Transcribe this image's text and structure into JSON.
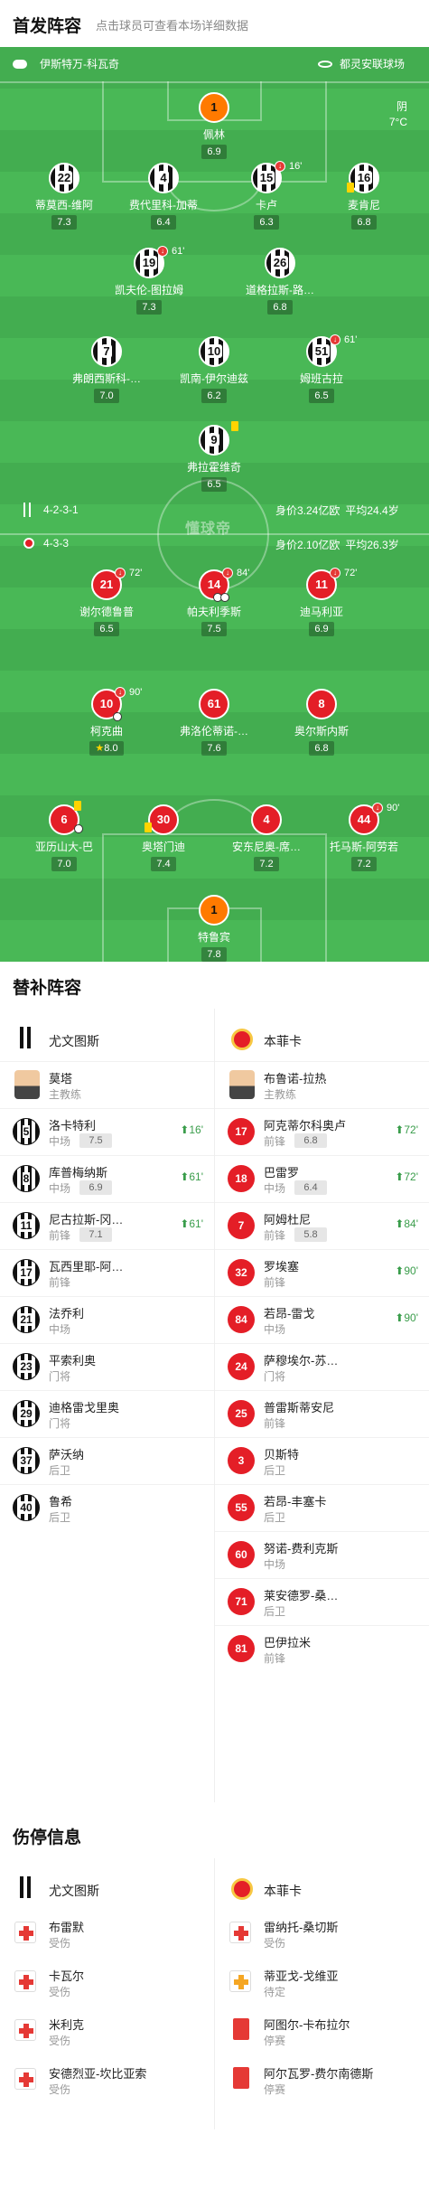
{
  "header": {
    "title": "首发阵容",
    "subtitle": "点击球员可查看本场详细数据"
  },
  "match": {
    "referee": "伊斯特万-科瓦奇",
    "venue": "都灵安联球场",
    "weather": "阴",
    "temperature": "7°C",
    "watermark": "懂球帝"
  },
  "home": {
    "name": "尤文图斯",
    "formation": "4-2-3-1",
    "value": "身价3.24亿欧",
    "avg_age": "平均24.4岁",
    "players": [
      {
        "num": "1",
        "name": "佩林",
        "rating": "6.9",
        "gk": true
      },
      {
        "num": "22",
        "name": "蒂莫西-维阿",
        "rating": "7.3"
      },
      {
        "num": "4",
        "name": "费代里科-加蒂",
        "rating": "6.4"
      },
      {
        "num": "15",
        "name": "卡卢",
        "rating": "6.3",
        "sub_min": "16'"
      },
      {
        "num": "16",
        "name": "麦肯尼",
        "rating": "6.8"
      },
      {
        "num": "19",
        "name": "凯夫伦-图拉姆",
        "rating": "7.3",
        "sub_min": "61'"
      },
      {
        "num": "26",
        "name": "道格拉斯-路…",
        "rating": "6.8"
      },
      {
        "num": "7",
        "name": "弗朗西斯科-…",
        "rating": "7.0"
      },
      {
        "num": "10",
        "name": "凯南-伊尔迪兹",
        "rating": "6.2"
      },
      {
        "num": "51",
        "name": "姆班古拉",
        "rating": "6.5",
        "sub_min": "61'"
      },
      {
        "num": "9",
        "name": "弗拉霍维奇",
        "rating": "6.5"
      }
    ]
  },
  "away": {
    "name": "本菲卡",
    "formation": "4-3-3",
    "value": "身价2.10亿欧",
    "avg_age": "平均26.3岁",
    "players": [
      {
        "num": "21",
        "name": "谢尔德鲁普",
        "rating": "6.5",
        "sub_min": "72'"
      },
      {
        "num": "14",
        "name": "帕夫利季斯",
        "rating": "7.5",
        "sub_min": "84'"
      },
      {
        "num": "11",
        "name": "迪马利亚",
        "rating": "6.9",
        "sub_min": "72'"
      },
      {
        "num": "10",
        "name": "柯克曲",
        "rating": "8.0",
        "sub_min": "90'",
        "star": "★"
      },
      {
        "num": "61",
        "name": "弗洛伦蒂诺-…",
        "rating": "7.6"
      },
      {
        "num": "8",
        "name": "奥尔斯内斯",
        "rating": "6.8"
      },
      {
        "num": "6",
        "name": "亚历山大-巴",
        "rating": "7.0"
      },
      {
        "num": "30",
        "name": "奥塔门迪",
        "rating": "7.4"
      },
      {
        "num": "4",
        "name": "安东尼奥-席…",
        "rating": "7.2"
      },
      {
        "num": "44",
        "name": "托马斯-阿劳若",
        "rating": "7.2",
        "sub_min": "90'"
      },
      {
        "num": "1",
        "name": "特鲁宾",
        "rating": "7.8",
        "gk": true
      }
    ]
  },
  "subs": {
    "title": "替补阵容",
    "home": [
      {
        "type": "coach",
        "name": "莫塔",
        "pos": "主教练"
      },
      {
        "num": "5",
        "name": "洛卡特利",
        "pos": "中场",
        "rating": "7.5",
        "sub_in": "16'"
      },
      {
        "num": "8",
        "name": "库普梅纳斯",
        "pos": "中场",
        "rating": "6.9",
        "sub_in": "61'"
      },
      {
        "num": "11",
        "name": "尼古拉斯-冈…",
        "pos": "前锋",
        "rating": "7.1",
        "sub_in": "61'"
      },
      {
        "num": "17",
        "name": "瓦西里耶-阿…",
        "pos": "前锋"
      },
      {
        "num": "21",
        "name": "法乔利",
        "pos": "中场"
      },
      {
        "num": "23",
        "name": "平索利奥",
        "pos": "门将"
      },
      {
        "num": "29",
        "name": "迪格雷戈里奥",
        "pos": "门将"
      },
      {
        "num": "37",
        "name": "萨沃纳",
        "pos": "后卫"
      },
      {
        "num": "40",
        "name": "鲁希",
        "pos": "后卫"
      }
    ],
    "away": [
      {
        "type": "coach",
        "name": "布鲁诺-拉热",
        "pos": "主教练"
      },
      {
        "num": "17",
        "name": "阿克蒂尔科奥卢",
        "pos": "前锋",
        "rating": "6.8",
        "sub_in": "72'"
      },
      {
        "num": "18",
        "name": "巴雷罗",
        "pos": "中场",
        "rating": "6.4",
        "sub_in": "72'"
      },
      {
        "num": "7",
        "name": "阿姆杜尼",
        "pos": "前锋",
        "rating": "5.8",
        "sub_in": "84'"
      },
      {
        "num": "32",
        "name": "罗埃塞",
        "pos": "前锋",
        "sub_in": "90'"
      },
      {
        "num": "84",
        "name": "若昂-雷戈",
        "pos": "中场",
        "sub_in": "90'"
      },
      {
        "num": "24",
        "name": "萨穆埃尔-苏…",
        "pos": "门将"
      },
      {
        "num": "25",
        "name": "普雷斯蒂安尼",
        "pos": "前锋"
      },
      {
        "num": "3",
        "name": "贝斯特",
        "pos": "后卫"
      },
      {
        "num": "55",
        "name": "若昂-丰塞卡",
        "pos": "后卫"
      },
      {
        "num": "60",
        "name": "努诺-费利克斯",
        "pos": "中场"
      },
      {
        "num": "71",
        "name": "莱安德罗-桑…",
        "pos": "后卫"
      },
      {
        "num": "81",
        "name": "巴伊拉米",
        "pos": "前锋"
      }
    ]
  },
  "injuries": {
    "title": "伤停信息",
    "home": [
      {
        "name": "布雷默",
        "status": "受伤",
        "icon": "injury"
      },
      {
        "name": "卡瓦尔",
        "status": "受伤",
        "icon": "injury"
      },
      {
        "name": "米利克",
        "status": "受伤",
        "icon": "injury"
      },
      {
        "name": "安德烈亚-坎比亚索",
        "status": "受伤",
        "icon": "injury"
      }
    ],
    "away": [
      {
        "name": "雷纳托-桑切斯",
        "status": "受伤",
        "icon": "injury"
      },
      {
        "name": "蒂亚戈-戈维亚",
        "status": "待定",
        "icon": "doubtful"
      },
      {
        "name": "阿图尔-卡布拉尔",
        "status": "停赛",
        "icon": "red-card"
      },
      {
        "name": "阿尔瓦罗-费尔南德斯",
        "status": "停赛",
        "icon": "red-card"
      }
    ]
  }
}
